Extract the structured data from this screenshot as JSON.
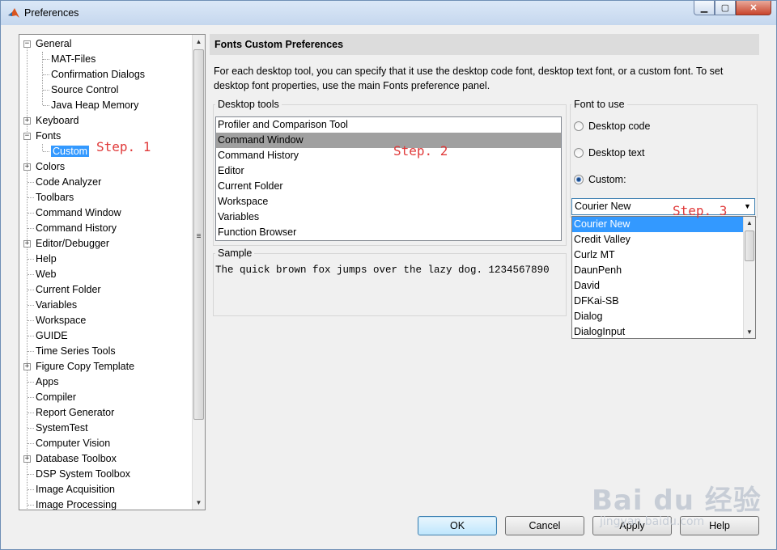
{
  "window": {
    "title": "Preferences"
  },
  "tree": {
    "items": [
      {
        "label": "General",
        "level": 0,
        "toggle": "−"
      },
      {
        "label": "MAT-Files",
        "level": 1
      },
      {
        "label": "Confirmation Dialogs",
        "level": 1
      },
      {
        "label": "Source Control",
        "level": 1
      },
      {
        "label": "Java Heap Memory",
        "level": 1
      },
      {
        "label": "Keyboard",
        "level": 0,
        "toggle": "+"
      },
      {
        "label": "Fonts",
        "level": 0,
        "toggle": "−"
      },
      {
        "label": "Custom",
        "level": 1,
        "selected": true
      },
      {
        "label": "Colors",
        "level": 0,
        "toggle": "+"
      },
      {
        "label": "Code Analyzer",
        "level": 0
      },
      {
        "label": "Toolbars",
        "level": 0
      },
      {
        "label": "Command Window",
        "level": 0
      },
      {
        "label": "Command History",
        "level": 0
      },
      {
        "label": "Editor/Debugger",
        "level": 0,
        "toggle": "+"
      },
      {
        "label": "Help",
        "level": 0
      },
      {
        "label": "Web",
        "level": 0
      },
      {
        "label": "Current Folder",
        "level": 0
      },
      {
        "label": "Variables",
        "level": 0
      },
      {
        "label": "Workspace",
        "level": 0
      },
      {
        "label": "GUIDE",
        "level": 0
      },
      {
        "label": "Time Series Tools",
        "level": 0
      },
      {
        "label": "Figure Copy Template",
        "level": 0,
        "toggle": "+"
      },
      {
        "label": "Apps",
        "level": 0
      },
      {
        "label": "Compiler",
        "level": 0
      },
      {
        "label": "Report Generator",
        "level": 0
      },
      {
        "label": "SystemTest",
        "level": 0
      },
      {
        "label": "Computer Vision",
        "level": 0
      },
      {
        "label": "Database Toolbox",
        "level": 0,
        "toggle": "+"
      },
      {
        "label": "DSP System Toolbox",
        "level": 0
      },
      {
        "label": "Image Acquisition",
        "level": 0
      },
      {
        "label": "Image Processing",
        "level": 0
      }
    ]
  },
  "panel": {
    "title": "Fonts Custom Preferences",
    "description": "For each desktop tool, you can specify that it use the desktop code font, desktop text font, or a custom font.  To set desktop font properties, use the main Fonts preference panel.",
    "desktop_tools_label": "Desktop tools",
    "desktop_tools": [
      {
        "label": "Profiler and Comparison Tool"
      },
      {
        "label": "Command Window",
        "selected": true
      },
      {
        "label": "Command History"
      },
      {
        "label": "Editor"
      },
      {
        "label": "Current Folder"
      },
      {
        "label": "Workspace"
      },
      {
        "label": "Variables"
      },
      {
        "label": "Function Browser"
      }
    ],
    "font_to_use_label": "Font to use",
    "radios": [
      {
        "label": "Desktop code",
        "checked": false
      },
      {
        "label": "Desktop text",
        "checked": false
      },
      {
        "label": "Custom:",
        "checked": true
      }
    ],
    "font_combo_value": "Courier New",
    "font_options": [
      {
        "label": "Courier New",
        "selected": true
      },
      {
        "label": "Credit Valley"
      },
      {
        "label": "Curlz MT"
      },
      {
        "label": "DaunPenh"
      },
      {
        "label": "David"
      },
      {
        "label": "DFKai-SB"
      },
      {
        "label": "Dialog"
      },
      {
        "label": "DialogInput"
      }
    ],
    "sample_label": "Sample",
    "sample_text": "The quick brown fox jumps over the lazy dog.  1234567890"
  },
  "annotations": {
    "step1": "Step. 1",
    "step2": "Step. 2",
    "step3": "Step. 3"
  },
  "buttons": {
    "ok": "OK",
    "cancel": "Cancel",
    "apply": "Apply",
    "help": "Help"
  },
  "watermark": {
    "logo": "Bai du 经验",
    "url": "jingyan.baidu.com"
  },
  "icons": {
    "app": "matlab-icon",
    "minimize": "minimize-icon",
    "maximize": "maximize-icon",
    "close": "close-icon",
    "scroll_up": "arrow-up-icon",
    "scroll_down": "arrow-down-icon",
    "dropdown": "chevron-down-icon"
  }
}
